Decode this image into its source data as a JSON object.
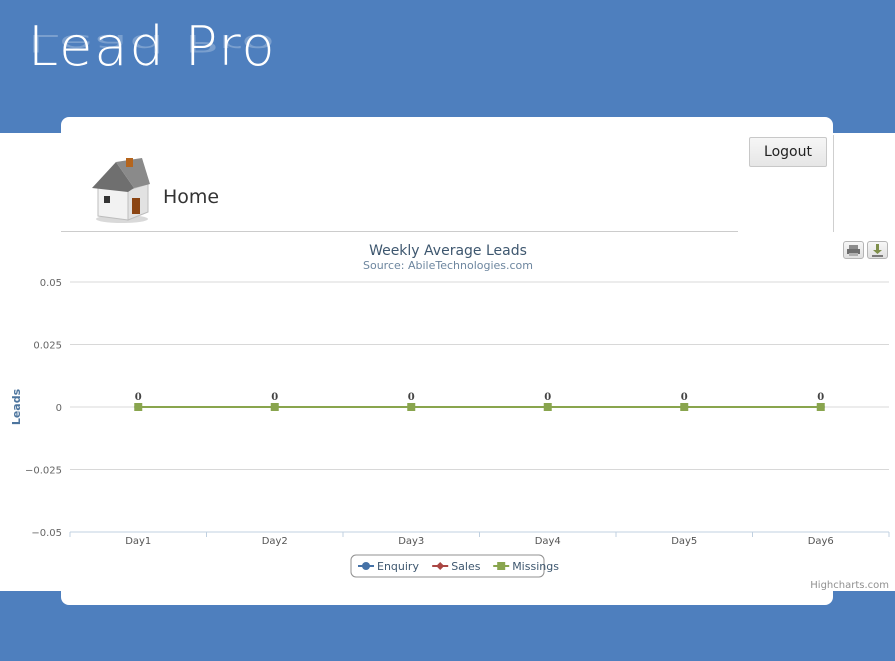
{
  "header": {
    "logo_text": "Lead Pro"
  },
  "toolbar": {
    "logout_label": "Logout"
  },
  "page": {
    "title": "Home"
  },
  "chart_export": {
    "print_icon": "print-icon",
    "download_icon": "download-icon"
  },
  "chart_data": {
    "type": "line",
    "title": "Weekly Average Leads",
    "subtitle": "Source: AbileTechnologies.com",
    "xlabel": "",
    "ylabel": "Leads",
    "categories": [
      "Day1",
      "Day2",
      "Day3",
      "Day4",
      "Day5",
      "Day6"
    ],
    "y_ticks": [
      "0.05",
      "0.025",
      "0",
      "−0.025",
      "−0.05"
    ],
    "ylim": [
      -0.05,
      0.05
    ],
    "grid": true,
    "data_labels": true,
    "legend_position": "bottom-center",
    "series": [
      {
        "name": "Enquiry",
        "values": [
          0,
          0,
          0,
          0,
          0,
          0
        ],
        "color": "#4572a7",
        "marker": "circle"
      },
      {
        "name": "Sales",
        "values": [
          0,
          0,
          0,
          0,
          0,
          0
        ],
        "color": "#aa4643",
        "marker": "diamond"
      },
      {
        "name": "Missings",
        "values": [
          0,
          0,
          0,
          0,
          0,
          0
        ],
        "color": "#89a54e",
        "marker": "square"
      }
    ],
    "credits": "Highcharts.com"
  }
}
